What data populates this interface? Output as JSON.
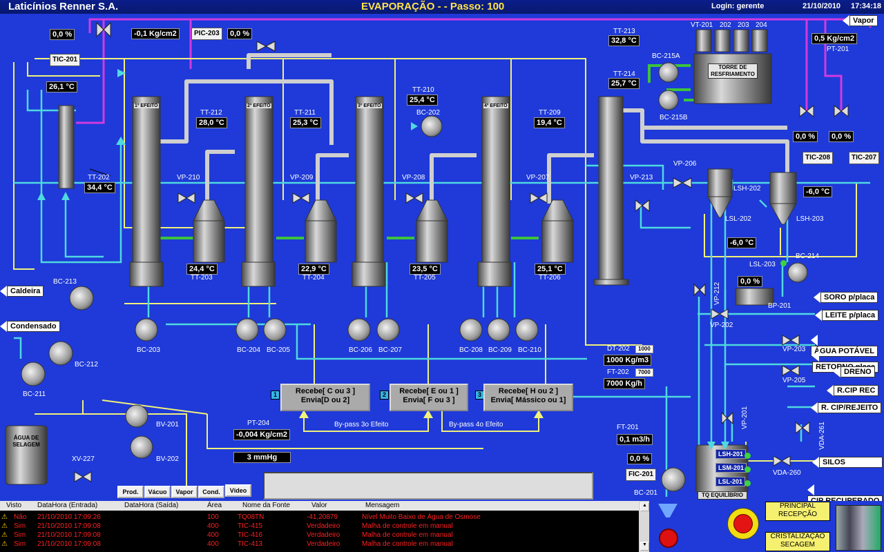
{
  "header": {
    "company": "Laticínios Renner S.A.",
    "title": "EVAPORAÇÃO -  - Passo: 100",
    "login": "Login: gerente",
    "date": "21/10/2010",
    "time": "17:34:18"
  },
  "readouts": {
    "tic201_out": "0,0 %",
    "tic201_pv": "26,1 °C",
    "pic203_pv": "-0,1 Kg/cm2",
    "pic203_out": "0,0 %",
    "tt202": "34,4 °C",
    "tt212": "28,0 °C",
    "tt211": "25,3 °C",
    "tt210": "25,4 °C",
    "tt209": "19,4 °C",
    "tt213": "32,8 °C",
    "tt214": "25,7 °C",
    "pt201": "0,5 Kg/cm2",
    "tt203": "24,4 °C",
    "tt204": "22,9 °C",
    "tt205": "23,5 °C",
    "tt206": "25,1 °C",
    "tic208_out": "0,0 %",
    "tic207_out": "0,0 %",
    "lsh202_temp": "-6,0 °C",
    "lsl202_temp": "-6,0 °C",
    "bp201_pct": "0,0 %",
    "dt202": "1000 Kg/m3",
    "ft202": "7000 Kg/h",
    "dt202_set": "1000",
    "ft202_set": "7000",
    "ft201": "0,1 m3/h",
    "fic201_out": "0,0 %",
    "pt204": "-0,004 Kg/cm2",
    "pt204b": "3 mmHg"
  },
  "tags": {
    "tic201": "TIC-201",
    "pic203": "PIC-203",
    "tic208": "TIC-208",
    "tic207": "TIC-207",
    "fic201": "FIC-201"
  },
  "labels": {
    "tt212": "TT-212",
    "tt211": "TT-211",
    "tt210": "TT-210",
    "tt209": "TT-209",
    "tt213": "TT-213",
    "tt214": "TT-214",
    "tt202": "TT-202",
    "tt203": "TT-203",
    "tt204": "TT-204",
    "tt205": "TT-205",
    "tt206": "TT-206",
    "pt201": "PT-201",
    "pt204": "PT-204",
    "dt202": "DT-202",
    "ft202": "FT-202",
    "ft201": "FT-201",
    "vp210": "VP-210",
    "vp209": "VP-209",
    "vp208": "VP-208",
    "vp207": "VP-207",
    "vp206": "VP-206",
    "vp213": "VP-213",
    "vp212": "VP-212",
    "vp202": "VP-202",
    "vp203": "VP-203",
    "vp205": "VP-205",
    "vp201": "VP-201",
    "vda261": "VDA-261",
    "vda260": "VDA-260",
    "bc202": "BC-202",
    "bc203": "BC-203",
    "bc204": "BC-204",
    "bc205": "BC-205",
    "bc206": "BC-206",
    "bc207": "BC-207",
    "bc208": "BC-208",
    "bc209": "BC-209",
    "bc210": "BC-210",
    "bc211": "BC-211",
    "bc212": "BC-212",
    "bc213": "BC-213",
    "bc214": "BC-214",
    "bc215a": "BC-215A",
    "bc215b": "BC-215B",
    "bc201": "BC-201",
    "bp201": "BP-201",
    "bv201": "BV-201",
    "bv202": "BV-202",
    "xv227": "XV-227",
    "lsh202": "LSH-202",
    "lsl202": "LSL-202",
    "lsh203": "LSH-203",
    "lsl203": "LSL-203",
    "vt201": "VT-201",
    "vt202": "202",
    "vt203": "203",
    "vt204": "204",
    "tower": "TORRE DE RESFRIAMENTO",
    "agua": "ÁGUA DE SELAGEM",
    "tq": "TQ EQUILÍBRIO",
    "lsh201": "LSH-201",
    "lsm201": "LSM-201",
    "lsl201": "LSL-201",
    "bypass3": "By-pass 3o Efeito",
    "bypass4": "By-pass 4o Efeito",
    "efeito1": "1º EFEITO",
    "efeito2": "2º EFEITO",
    "efeito3": "3º EFEITO",
    "efeito4": "4º EFEITO"
  },
  "streams": {
    "vapor": "Vapor",
    "caldeira": "Caldeira",
    "condensado": "Condensado",
    "soro": "SORO p/placa",
    "leite": "LEITE p/placa",
    "agua_potavel": "ÁGUA POTÁVEL",
    "retorno": "RETORNO placa",
    "dreno": "DRENO",
    "rcip_rec": "R.CIP REC",
    "rcip_rejeito": "R. CIP/REJEITO",
    "silos": "SILOS",
    "cip_recuperado": "CIP RECUPERADO"
  },
  "commands": [
    {
      "num": "1",
      "line1": "Recebe[ C ou 3 ]",
      "line2": "Envia[D ou 2]"
    },
    {
      "num": "2",
      "line1": "Recebe[ E ou 1 ]",
      "line2": "Envia[ F ou 3 ]"
    },
    {
      "num": "3",
      "line1": "Recebe[ H ou 2 ]",
      "line2": "Envia[ Mássico ou 1]"
    }
  ],
  "nav_buttons": [
    "Prod.",
    "Vácuo",
    "Vapor",
    "Cond.",
    "Vídeo"
  ],
  "screen_buttons": {
    "principal": "PRINCIPAL",
    "recepcao": "RECEPÇÃO",
    "cristalizacao": "CRISTALIZAÇÃO",
    "secagem": "SECAGEM"
  },
  "alarms": {
    "columns": [
      "Visto",
      "DataHora (Entrada)",
      "DataHora (Saída)",
      "Área",
      "Nome da Fonte",
      "Valor",
      "Mensagem"
    ],
    "rows": [
      [
        "Não",
        "21/10/2010 17:09:26",
        "",
        "100",
        "TQ08TN",
        "-41,20879",
        "Nível Muito Baixo de Água de Osmose"
      ],
      [
        "Sim",
        "21/10/2010 17:09:08",
        "",
        "400",
        "TIC-415",
        "Verdadeiro",
        "Malha de controle em manual"
      ],
      [
        "Sim",
        "21/10/2010 17:09:08",
        "",
        "400",
        "TIC-416",
        "Verdadeiro",
        "Malha de controle em manual"
      ],
      [
        "Sim",
        "21/10/2010 17:09:08",
        "",
        "400",
        "TIC-413",
        "Verdadeiro",
        "Malha de controle em manual"
      ]
    ]
  },
  "colors": {
    "background": "#1f3ad8",
    "pipe_yellow": "#f2f27a",
    "pipe_cyan": "#4fd9e0",
    "pipe_magenta": "#d23adf",
    "pipe_green": "#3cc43c",
    "alarm_red": "#ff2020"
  }
}
